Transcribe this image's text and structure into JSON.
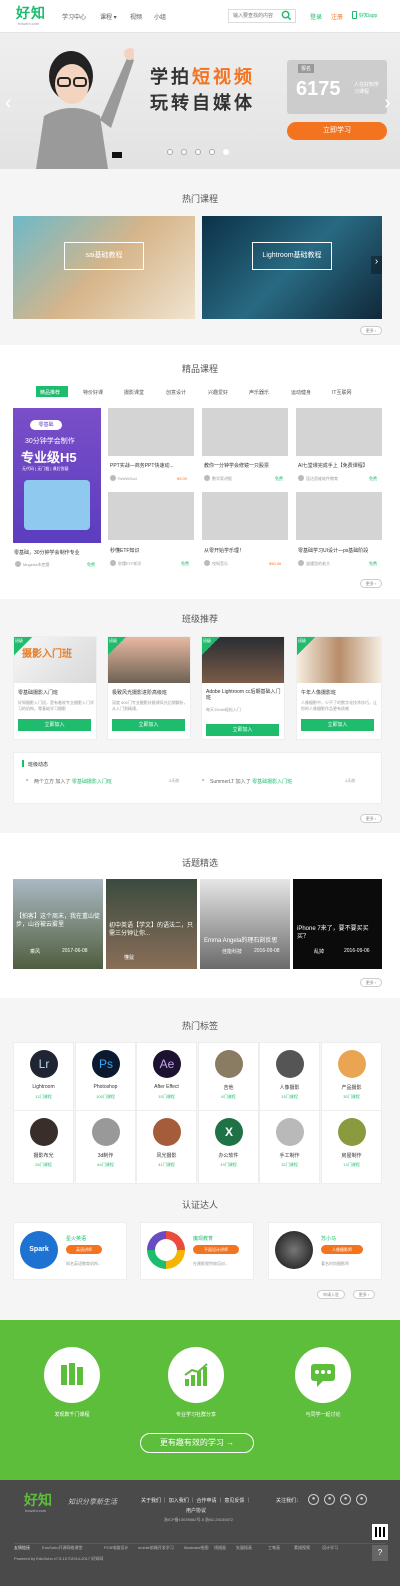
{
  "colors": {
    "accent": "#1fbc6e",
    "orange": "#f3731f"
  },
  "header": {
    "logo": "好知",
    "logo_sub": "howzhi.com",
    "nav": [
      "学习中心",
      "课程 ▾",
      "视频",
      "小组"
    ],
    "search_placeholder": "输入要查找的内容",
    "login": "登录",
    "register": "注册",
    "app": "好知app"
  },
  "banner": {
    "slogan1_a": "学拍",
    "slogan1_b": "短视频",
    "slogan2": "玩转自媒体",
    "ghost_badge": "报名",
    "ghost_num": "6175",
    "ghost_txt": "人在好知学习课程",
    "cta": "立即学习"
  },
  "hot": {
    "title": "热门课程",
    "items": [
      "sai基础教程",
      "Lightroom基础教程"
    ],
    "more": "更多 ›"
  },
  "fine": {
    "title": "精品课程",
    "tabs": [
      "精品推荐",
      "特价好课",
      "摄影课堂",
      "创意设计",
      "兴趣爱好",
      "声乐器乐",
      "运动健身",
      "IT互联网"
    ],
    "feature": {
      "tag": "零基础",
      "line1": "30分钟学会制作",
      "line2": "专业级H5",
      "line3": "无代码 | 无门槛 | 课后答疑",
      "title": "零基础，30分钟学会制作专业",
      "author": "Mugeda木疙瘩",
      "price": "免费"
    },
    "cards": [
      {
        "title": "PPT实战—商务PPT快速动...",
        "author": "RedWGod",
        "price": "¥9.00",
        "paid": true
      },
      {
        "title": "教你一分钟学会修镜一只股票",
        "author": "数学家讲股",
        "price": "免费",
        "paid": false
      },
      {
        "title": "AI七堂课完成手上【免费课程】",
        "author": "昆达思维软件教育",
        "price": "免费",
        "paid": false
      },
      {
        "title": "秒懂ETF知识",
        "author": "秒懂ETF知识",
        "price": "免费",
        "paid": false
      },
      {
        "title": "从零开始学乐理！",
        "author": "哎呀音乐",
        "price": "¥50.00",
        "paid": true
      },
      {
        "title": "零基础学习UI设计—ps基础阶段",
        "author": "道遇思的老大",
        "price": "免费",
        "paid": false
      }
    ],
    "more": "更多 ›"
  },
  "classes": {
    "title": "班级推荐",
    "tag": "班级",
    "items": [
      {
        "img": "摄影入门班",
        "name": "零基础摄影入门班",
        "desc": "好知摄影入门班，是有着较专业摄影入门学习的机构，零基础学习摄影",
        "btn": "立即加入"
      },
      {
        "name": "极致风光摄影进阶高级班",
        "desc": "深度 500门专业摄影技能课风光后期解析，从入门到精通，",
        "btn": "立即加入"
      },
      {
        "name": "Adobe Lightroom cc后期基础入门班",
        "desc": "每天10min轻松入门",
        "btn": "立即加入"
      },
      {
        "name": "午年人像摄影班",
        "desc": "人像摄影中，少不了的数字化技术技巧，让你的人像摄影作品更有质感",
        "btn": "立即加入"
      }
    ],
    "feed_title": "班级动态",
    "feed": [
      {
        "user": "两个立方",
        "verb": "加入了",
        "target": "零基础摄影入门班",
        "time": "3天前"
      },
      {
        "user": "SummerLT",
        "verb": "加入了",
        "target": "零基础摄影入门班",
        "time": "4天前"
      }
    ],
    "more": "更多 ›"
  },
  "topics": {
    "title": "话题精选",
    "items": [
      {
        "title": "【拍客】这个周末，我在重山徒步，山谷被云雾里",
        "user": "乘风",
        "date": "2017-06-08"
      },
      {
        "title": "初中英语【学文】的语法二，只需三分钟让你...",
        "user": "懂鼠",
        "date": ""
      },
      {
        "title": "Emma Angela的理石刻反思",
        "user": "佳能科技",
        "date": "2016-09-08"
      },
      {
        "title": "iPhone 7来了，要不要买买买？",
        "user": "乱掉",
        "date": "2016-09-06"
      }
    ],
    "more": "更多 ›"
  },
  "tags": {
    "title": "热门标签",
    "items": [
      {
        "name": "Lightroom",
        "count": "12门课程",
        "icon": "Lr",
        "bg": "#1f2532",
        "fg": "#c1d6f0"
      },
      {
        "name": "Photoshop",
        "count": "100门课程",
        "icon": "Ps",
        "bg": "#0b1a2e",
        "fg": "#3aa8f2"
      },
      {
        "name": "After Effect",
        "count": "15门课程",
        "icon": "Ae",
        "bg": "#1d1230",
        "fg": "#c9a5f5"
      },
      {
        "name": "吉他",
        "count": "8门课程",
        "icon": "",
        "bg": "#8a7b63",
        "fg": "#fff"
      },
      {
        "name": "人像摄影",
        "count": "15门课程",
        "icon": "",
        "bg": "#555",
        "fg": "#fff"
      },
      {
        "name": "产品摄影",
        "count": "30门课程",
        "icon": "",
        "bg": "#e9a552",
        "fg": "#fff"
      },
      {
        "name": "摄影布光",
        "count": "26门课程",
        "icon": "",
        "bg": "#3a2e2b",
        "fg": "#fff"
      },
      {
        "name": "3d制作",
        "count": "64门课程",
        "icon": "",
        "bg": "#999",
        "fg": "#fff"
      },
      {
        "name": "风光摄影",
        "count": "41门课程",
        "icon": "",
        "bg": "#a55c3a",
        "fg": "#fff"
      },
      {
        "name": "办公软件",
        "count": "19门课程",
        "icon": "X",
        "bg": "#1e7245",
        "fg": "#fff"
      },
      {
        "name": "手工制作",
        "count": "32门课程",
        "icon": "",
        "bg": "#b9b9b9",
        "fg": "#fff"
      },
      {
        "name": "房屋制作",
        "count": "13门课程",
        "icon": "",
        "bg": "#8a9a3e",
        "fg": "#fff"
      }
    ]
  },
  "experts": {
    "title": "认证达人",
    "items": [
      {
        "name": "星火英语",
        "badge": "英语讲师",
        "desc": "知名英语教育机构..."
      },
      {
        "name": "魔现教育",
        "badge": "平面设计讲师",
        "desc": "在建影视特效培训..."
      },
      {
        "name": "苏小马",
        "badge": "人像摄影师",
        "desc": "著名时尚摄影师"
      }
    ],
    "apply": "申请入驻",
    "more": "更多 ›"
  },
  "promo": {
    "items": [
      "发现数千门课程",
      "专业学习社群分享",
      "与同学一起讨论"
    ],
    "btn": "更有趣有效的学习 →"
  },
  "footer": {
    "logo": "好知",
    "logo_sub": "howzhi.com",
    "slogan": "知识分享新生活",
    "links": "关于我们 ｜ 加入我们 ｜ 合作申请 ｜ 意见反馈 ｜",
    "links2": "用户协议",
    "icp": "浙ICP备13039562号-5   浙B2-20150872",
    "follow": "关注我们：",
    "friend_links": [
      "友情链接",
      "EduSoho开源网络课堂",
      "PCB电路设计",
      "mobile前端开发学习",
      "Illustrator绘图",
      "线描画",
      "矢量插画",
      "工笔画",
      "素描视频",
      "设计学习"
    ],
    "copyright": "Powered by EduSoho v7.5.15 ©2014-2017   好知网"
  }
}
